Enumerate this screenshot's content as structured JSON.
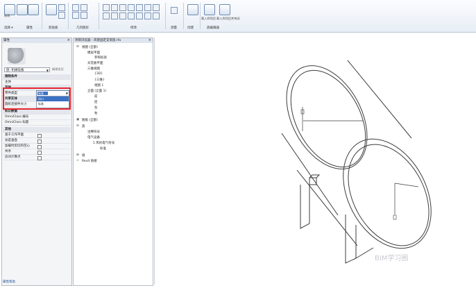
{
  "ribbon": {
    "groups": [
      "选择 ▾",
      "属性",
      "剪贴板",
      "几何图形",
      "修改",
      "测量",
      "创建",
      "族编辑器"
    ],
    "modify_label": "修改",
    "buttons": [
      "载入到项目",
      "载入到项目并关闭"
    ]
  },
  "properties": {
    "title": "属性",
    "type_selector": "族: 机械设备",
    "edit_type": "编辑类型",
    "rows": [
      {
        "label": "限制条件",
        "kind": "section"
      },
      {
        "label": "主体",
        "kind": "row"
      },
      {
        "label": "其他",
        "kind": "section"
      },
      {
        "label": "零件类型",
        "kind": "row",
        "value": "标准"
      },
      {
        "label": "共享实体",
        "kind": "section"
      },
      {
        "label": "圆形连接件大小",
        "kind": "row"
      },
      {
        "label": "标识数据",
        "kind": "section"
      },
      {
        "label": "OmniClass 编号",
        "kind": "row"
      },
      {
        "label": "OmniClass 标题",
        "kind": "row"
      },
      {
        "label": "其他",
        "kind": "section"
      },
      {
        "label": "基于工作平面",
        "kind": "check"
      },
      {
        "label": "总是垂直",
        "kind": "check"
      },
      {
        "label": "加载时剪切的空心",
        "kind": "check"
      },
      {
        "label": "共享",
        "kind": "check"
      },
      {
        "label": "房间计算点",
        "kind": "check"
      }
    ],
    "dropdown": {
      "selected": "标准",
      "options": [
        "风口",
        "标准"
      ]
    },
    "footer": "属性帮助"
  },
  "browser": {
    "title": "项目浏览器 - 风管固定支架族.rfa",
    "tree": [
      "视图 (全部)",
      "楼层平面",
      "参照标高",
      "天花板平面",
      "三维视图",
      "{3D}",
      "{三维}",
      "视图 1",
      "立面 (立面 1)",
      "前",
      "后",
      "左",
      "右",
      "图纸 (全部)",
      "族",
      "注释符号",
      "电气设备",
      "1 风机电气符号",
      "标准",
      "组",
      "Revit 链接"
    ]
  },
  "canvas": {
    "watermark": "BIM学习圈"
  }
}
